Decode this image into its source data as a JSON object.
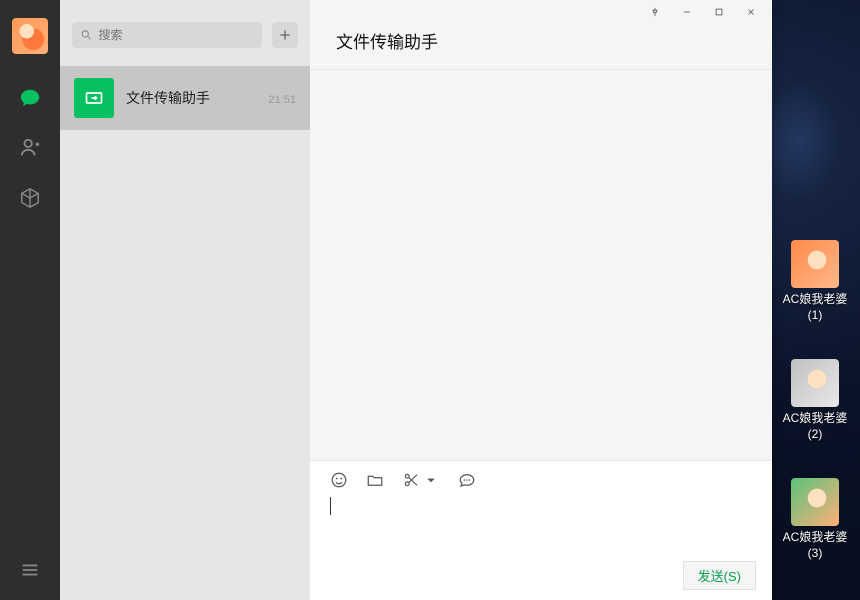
{
  "search": {
    "placeholder": "搜索"
  },
  "chats": [
    {
      "title": "文件传输助手",
      "time": "21:51"
    }
  ],
  "header": {
    "title": "文件传输助手"
  },
  "composer": {
    "send_label": "发送(S)"
  },
  "desktop_icons": [
    {
      "label": "AC娘我老婆 (1)"
    },
    {
      "label": "AC娘我老婆 (2)"
    },
    {
      "label": "AC娘我老婆 (3)"
    }
  ]
}
